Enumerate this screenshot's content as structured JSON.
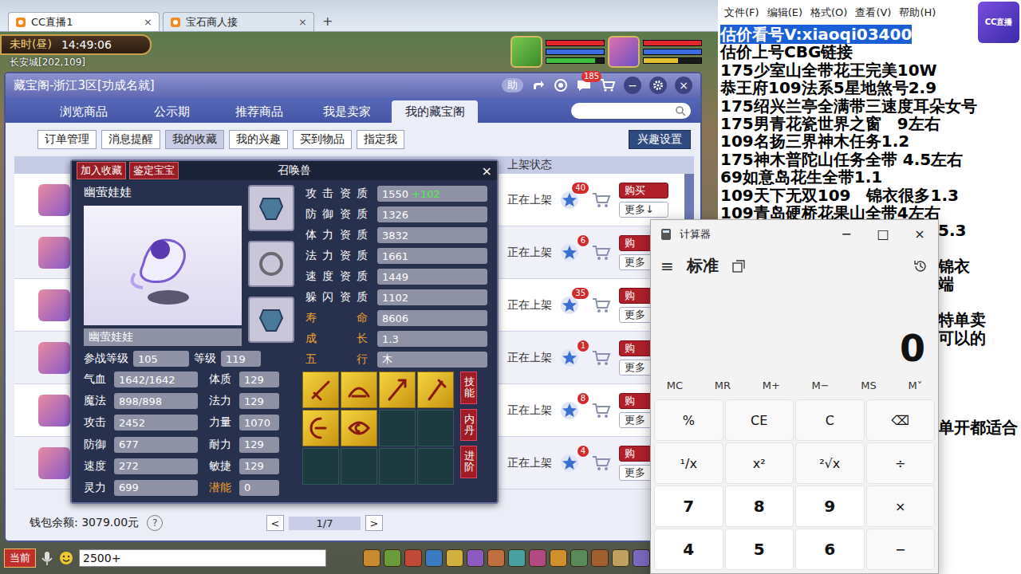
{
  "browser": {
    "tabs": [
      {
        "label": "CC直播1",
        "selected": true,
        "close": "×"
      },
      {
        "label": "宝石商人接",
        "selected": false,
        "close": "×"
      }
    ],
    "new_tab": "+"
  },
  "hud": {
    "period": "未时(昼)",
    "clock": "14:49:06",
    "location": "长安城[202,109]",
    "pet_bars": [
      {
        "level": 1,
        "color": "#e02828"
      },
      {
        "level": 1,
        "color": "#3a6ee0"
      },
      {
        "level": 0.85,
        "color": "#3fbf3f"
      }
    ],
    "player_bars": [
      {
        "level": 1,
        "color": "#e02828"
      },
      {
        "level": 1,
        "color": "#3a6ee0"
      },
      {
        "level": 0.6,
        "color": "#e0c030"
      }
    ]
  },
  "cbg": {
    "title": "藏宝阁-浙江3区[功成名就]",
    "help": "助",
    "messages": "185",
    "minimize": "−",
    "close": "×",
    "nav": [
      {
        "label": "浏览商品",
        "selected": false
      },
      {
        "label": "公示期",
        "selected": false
      },
      {
        "label": "推荐商品",
        "selected": false
      },
      {
        "label": "我是卖家",
        "selected": false
      },
      {
        "label": "我的藏宝阁",
        "selected": true
      }
    ],
    "subnav": [
      {
        "label": "订单管理",
        "selected": false
      },
      {
        "label": "消息提醒",
        "selected": false
      },
      {
        "label": "我的收藏",
        "selected": true
      },
      {
        "label": "我的兴趣",
        "selected": false
      },
      {
        "label": "买到物品",
        "selected": false
      },
      {
        "label": "指定我",
        "selected": false
      }
    ],
    "interest_settings": "兴趣设置",
    "column": "上架状态",
    "rows": [
      {
        "status": "正在上架",
        "favorites": "40",
        "buy": "购买",
        "more": "更多↓"
      },
      {
        "status": "正在上架",
        "favorites": "6",
        "buy": "购",
        "more": "更多"
      },
      {
        "status": "正在上架",
        "favorites": "35",
        "buy": "购",
        "more": "更多"
      },
      {
        "status": "正在上架",
        "favorites": "1",
        "buy": "购",
        "more": "更多"
      },
      {
        "status": "正在上架",
        "favorites": "8",
        "buy": "购",
        "more": "更多"
      },
      {
        "status": "正在上架",
        "favorites": "4",
        "buy": "购",
        "more": "更多"
      }
    ],
    "wallet": "钱包余额: 3079.00元",
    "help_mark": "?",
    "prev": "<",
    "page": "1/7",
    "next": ">"
  },
  "pet": {
    "add_favorite": "加入收藏",
    "appraise": "鉴定宝宝",
    "title": "召唤兽",
    "close": "×",
    "name": "幽萤娃娃",
    "label": "幽萤娃娃",
    "equipment": [
      {
        "filled": true
      },
      {
        "filled": true
      },
      {
        "filled": true
      }
    ],
    "aptitudes": [
      {
        "label": "攻击资质",
        "value": "1550",
        "bonus": "+102",
        "color": "#ffffff"
      },
      {
        "label": "防御资质",
        "value": "1326",
        "bonus": "",
        "color": "#ffffff"
      },
      {
        "label": "体力资质",
        "value": "3832",
        "bonus": "",
        "color": "#ffffff"
      },
      {
        "label": "法力资质",
        "value": "1661",
        "bonus": "",
        "color": "#ffffff"
      },
      {
        "label": "速度资质",
        "value": "1449",
        "bonus": "",
        "color": "#ffffff"
      },
      {
        "label": "躲闪资质",
        "value": "1102",
        "bonus": "",
        "color": "#ffffff"
      },
      {
        "label": "寿命",
        "value": "8606",
        "bonus": "",
        "color": "#f0a030"
      },
      {
        "label": "成长",
        "value": "1.3",
        "bonus": "",
        "color": "#f0a030"
      },
      {
        "label": "五行",
        "value": "木",
        "bonus": "",
        "color": "#f0a030"
      }
    ],
    "battle_level_label": "参战等级",
    "battle_level": "105",
    "level_label": "等级",
    "level": "119",
    "stats": [
      {
        "label": "气血",
        "value": "1642/1642",
        "attr": "体质",
        "attr_value": "129",
        "attr_color": "#ffffff"
      },
      {
        "label": "魔法",
        "value": "898/898",
        "attr": "法力",
        "attr_value": "129",
        "attr_color": "#ffffff"
      },
      {
        "label": "攻击",
        "value": "2452",
        "attr": "力量",
        "attr_value": "1070",
        "attr_color": "#ffffff"
      },
      {
        "label": "防御",
        "value": "677",
        "attr": "耐力",
        "attr_value": "129",
        "attr_color": "#ffffff"
      },
      {
        "label": "速度",
        "value": "272",
        "attr": "敏捷",
        "attr_value": "129",
        "attr_color": "#ffffff"
      },
      {
        "label": "灵力",
        "value": "699",
        "attr": "潜能",
        "attr_value": "0",
        "attr_color": "#f0a030"
      }
    ],
    "skills": [
      {
        "filled": true
      },
      {
        "filled": true
      },
      {
        "filled": true
      },
      {
        "filled": true
      },
      {
        "filled": true
      },
      {
        "filled": true
      },
      {
        "filled": false
      },
      {
        "filled": false
      },
      {
        "filled": false
      },
      {
        "filled": false
      },
      {
        "filled": false
      },
      {
        "filled": false
      }
    ],
    "side_buttons": [
      "技能",
      "内丹",
      "进阶"
    ]
  },
  "chat": {
    "channel": "当前",
    "input": "2500+"
  },
  "notepad": {
    "menu": [
      "文件(F)",
      "编辑(E)",
      "格式(O)",
      "查看(V)",
      "帮助(H)"
    ],
    "lines": [
      {
        "text": "估价看号V:xiaoqi03400",
        "selected": true,
        "clipped": false
      },
      {
        "text": "估价上号CBG链接",
        "selected": false,
        "clipped": false
      },
      {
        "text": "175少室山全带花王完美10W",
        "selected": false,
        "clipped": false
      },
      {
        "text": "恭王府109法系5星地煞号2.9",
        "selected": false,
        "clipped": false
      },
      {
        "text": "175绍兴兰亭全满带三速度耳朵女号",
        "selected": false,
        "clipped": false
      },
      {
        "text": "175男青花瓷世界之窗　9左右",
        "selected": false,
        "clipped": false
      },
      {
        "text": "109名扬三界神木任务1.2",
        "selected": false,
        "clipped": false
      },
      {
        "text": "175神木普陀山任务全带 4.5左右",
        "selected": false,
        "clipped": false
      },
      {
        "text": "69如意岛花生全带1.1",
        "selected": false,
        "clipped": false
      },
      {
        "text": "109天下无双109　锦衣很多1.3",
        "selected": false,
        "clipped": false
      },
      {
        "text": "109青岛硬桥花果山全带4左右",
        "selected": false,
        "clipped": false
      },
      {
        "text": "5.3",
        "selected": false,
        "clipped": true
      },
      {
        "text": "",
        "selected": false,
        "clipped": true
      },
      {
        "text": "锦衣",
        "selected": false,
        "clipped": true
      },
      {
        "text": "端",
        "selected": false,
        "clipped": true
      },
      {
        "text": "",
        "selected": false,
        "clipped": true
      },
      {
        "text": "特单卖",
        "selected": false,
        "clipped": true
      },
      {
        "text": "可以的",
        "selected": false,
        "clipped": true
      },
      {
        "text": "",
        "selected": false,
        "clipped": true
      },
      {
        "text": "",
        "selected": false,
        "clipped": true
      },
      {
        "text": "",
        "selected": false,
        "clipped": true
      },
      {
        "text": "",
        "selected": false,
        "clipped": true
      },
      {
        "text": "单开都适合",
        "selected": false,
        "clipped": true
      }
    ]
  },
  "calculator": {
    "title": "计算器",
    "controls": [
      "−",
      "□",
      "×"
    ],
    "menu": "≡",
    "mode": "标准",
    "display": "0",
    "memory": [
      "MC",
      "MR",
      "M+",
      "M−",
      "MS",
      "M˅"
    ],
    "keys": [
      {
        "label": "%",
        "kind": "op"
      },
      {
        "label": "CE",
        "kind": "op"
      },
      {
        "label": "C",
        "kind": "op"
      },
      {
        "label": "⌫",
        "kind": "op"
      },
      {
        "label": "¹/x",
        "kind": "op"
      },
      {
        "label": "x²",
        "kind": "op"
      },
      {
        "label": "²√x",
        "kind": "op"
      },
      {
        "label": "÷",
        "kind": "op"
      },
      {
        "label": "7",
        "kind": "digit"
      },
      {
        "label": "8",
        "kind": "digit"
      },
      {
        "label": "9",
        "kind": "digit"
      },
      {
        "label": "×",
        "kind": "op"
      },
      {
        "label": "4",
        "kind": "digit"
      },
      {
        "label": "5",
        "kind": "digit"
      },
      {
        "label": "6",
        "kind": "digit"
      },
      {
        "label": "−",
        "kind": "op"
      }
    ]
  },
  "logo": "CC直播"
}
